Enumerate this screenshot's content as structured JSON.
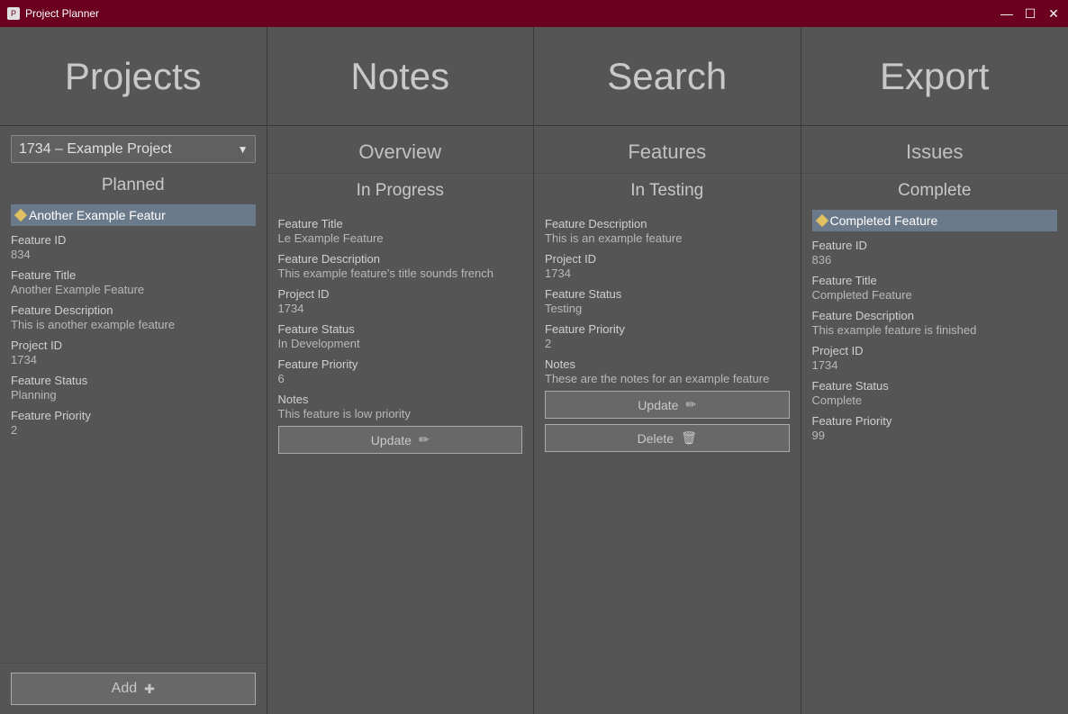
{
  "titlebar": {
    "title": "Project Planner",
    "controls": [
      "—",
      "☐",
      "✕"
    ]
  },
  "nav": {
    "items": [
      "Projects",
      "Notes",
      "Search",
      "Export"
    ]
  },
  "project_select": {
    "value": "1734 – Example Project",
    "options": [
      "1734 – Example Project"
    ]
  },
  "columns": [
    {
      "header": "Projects",
      "status_label": "Planned",
      "features": [
        {
          "header_selected": "Another Example Featur",
          "fields": [
            {
              "label": "Feature ID",
              "value": "834"
            },
            {
              "label": "Feature Title",
              "value": "Another Example Feature"
            },
            {
              "label": "Feature Description",
              "value": "This is another example feature"
            },
            {
              "label": "Project ID",
              "value": "1734"
            },
            {
              "label": "Feature Status",
              "value": "Planning"
            },
            {
              "label": "Feature Priority",
              "value": "2"
            }
          ],
          "buttons": []
        }
      ],
      "add_button": "Add"
    },
    {
      "header": "Overview",
      "status_label": "In Progress",
      "features": [
        {
          "fields": [
            {
              "label": "Feature Title",
              "value": "Le Example Feature"
            },
            {
              "label": "Feature Description",
              "value": "This example feature's title sounds french"
            },
            {
              "label": "Project ID",
              "value": "1734"
            },
            {
              "label": "Feature Status",
              "value": "In Development"
            },
            {
              "label": "Feature Priority",
              "value": "6"
            },
            {
              "label": "Notes",
              "value": "This feature is low priority"
            }
          ],
          "buttons": [
            "Update"
          ]
        }
      ]
    },
    {
      "header": "Features",
      "status_label": "In Testing",
      "features": [
        {
          "fields": [
            {
              "label": "Feature Description",
              "value": "This is an example feature"
            },
            {
              "label": "Project ID",
              "value": "1734"
            },
            {
              "label": "Feature Status",
              "value": "Testing"
            },
            {
              "label": "Feature Priority",
              "value": "2"
            },
            {
              "label": "Notes",
              "value": "These are the notes for an example feature"
            }
          ],
          "buttons": [
            "Update",
            "Delete"
          ]
        }
      ]
    },
    {
      "header": "Issues",
      "status_label": "Complete",
      "features": [
        {
          "header_selected": "Completed Feature",
          "fields": [
            {
              "label": "Feature ID",
              "value": "836"
            },
            {
              "label": "Feature Title",
              "value": "Completed Feature"
            },
            {
              "label": "Feature Description",
              "value": "This example feature is finished"
            },
            {
              "label": "Project ID",
              "value": "1734"
            },
            {
              "label": "Feature Status",
              "value": "Complete"
            },
            {
              "label": "Feature Priority",
              "value": "99"
            }
          ],
          "buttons": []
        }
      ]
    }
  ]
}
